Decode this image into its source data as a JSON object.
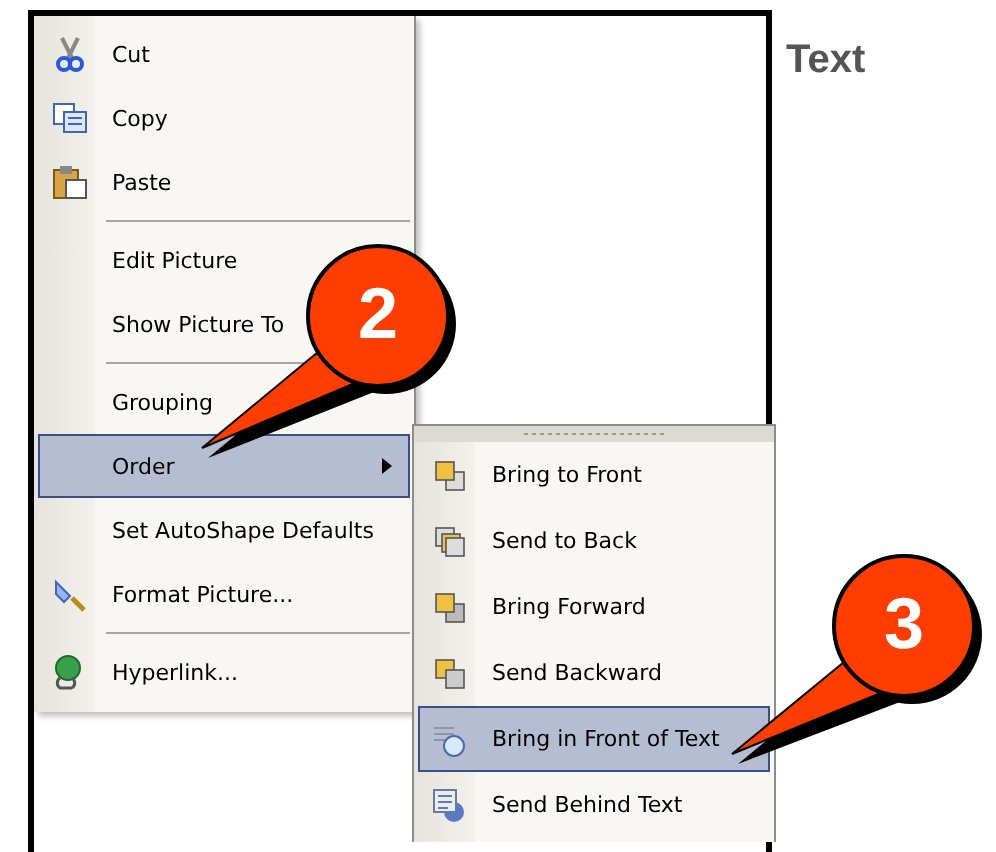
{
  "menu": {
    "items": [
      {
        "kind": "item",
        "label": "Cut",
        "selected": false,
        "submenu": false
      },
      {
        "kind": "item",
        "label": "Copy",
        "selected": false,
        "submenu": false
      },
      {
        "kind": "item",
        "label": "Paste",
        "selected": false,
        "submenu": false
      },
      {
        "kind": "separator"
      },
      {
        "kind": "item",
        "label": "Edit Picture",
        "selected": false,
        "submenu": false
      },
      {
        "kind": "item",
        "label": "Show Picture To",
        "selected": false,
        "submenu": false
      },
      {
        "kind": "separator"
      },
      {
        "kind": "item",
        "label": "Grouping",
        "selected": false,
        "submenu": false
      },
      {
        "kind": "item",
        "label": "Order",
        "selected": true,
        "submenu": true
      },
      {
        "kind": "item",
        "label": "Set AutoShape Defaults",
        "selected": false,
        "submenu": false
      },
      {
        "kind": "item",
        "label": "Format Picture...",
        "selected": false,
        "submenu": false
      },
      {
        "kind": "separator"
      },
      {
        "kind": "item",
        "label": "Hyperlink...",
        "selected": false,
        "submenu": false
      }
    ]
  },
  "submenu": {
    "items": [
      {
        "label": "Bring to Front",
        "selected": false
      },
      {
        "label": "Send to Back",
        "selected": false
      },
      {
        "label": "Bring Forward",
        "selected": false
      },
      {
        "label": "Send Backward",
        "selected": false
      },
      {
        "label": "Bring in Front of Text",
        "selected": true
      },
      {
        "label": "Send Behind Text",
        "selected": false
      }
    ]
  },
  "side_label": "Text",
  "callouts": [
    {
      "number": "2"
    },
    {
      "number": "3"
    }
  ]
}
